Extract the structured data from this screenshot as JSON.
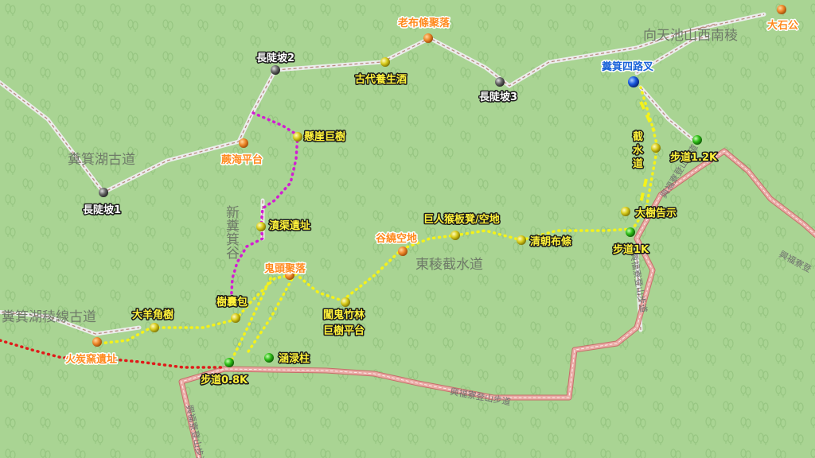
{
  "colors": {
    "background": "#a9d493",
    "road_fill": "#e9a9a4",
    "road_edge": "#c66e6a",
    "trail": "#e6e6e6",
    "trail_dash": "#b98a80",
    "magenta_path": "#d21ed2",
    "yellow_path": "#f4f21a",
    "red_path": "#e01a1a"
  },
  "area_labels": {
    "xiang_tian_chi": "向天池山西南稜",
    "ji_ji_hu_old_road": "糞箕湖古道",
    "xin_ji_ji_gu": "新糞箕谷",
    "ji_ji_hu_ridge_road": "糞箕湖稜線古道",
    "dong_ling": "東稜截水道"
  },
  "road_labels": {
    "xing_fu_bottom": "興福寮登山步道",
    "xing_fu_right_1": "興福寮登山步道",
    "xing_fu_right_2": "興福寮登山步道",
    "xing_fu_left": "興福寮登山步道",
    "xing_fu_far_right": "興福寮登"
  },
  "markers": {
    "da_shi_gong": {
      "label": "大石公",
      "icon": "orange-pin-icon"
    },
    "lao_bu_tiao": {
      "label": "老布條聚落",
      "icon": "orange-pin-icon"
    },
    "chang_dou_po_2": {
      "label": "長陡坡2",
      "icon": "gray-pin-icon"
    },
    "gu_dai_yang_sheng": {
      "label": "古代養生酒",
      "icon": "yellow-pin-icon"
    },
    "chang_dou_po_3": {
      "label": "長陡坡3",
      "icon": "gray-pin-icon"
    },
    "ji_ji_si_lu_cha": {
      "label": "糞箕四路叉",
      "icon": "blue-pin-icon"
    },
    "xuan_ya_ju_shu": {
      "label": "懸崖巨樹",
      "icon": "yellow-pin-icon"
    },
    "jue_hai_ping_tai": {
      "label": "蕨海平台",
      "icon": "orange-pin-icon"
    },
    "jie_shui_dao": {
      "label_lines": [
        "截",
        "水",
        "道"
      ],
      "icon": "yellow-pin-icon"
    },
    "bu_dao_12k": {
      "label": "步道1.2K",
      "icon": "green-pin-icon"
    },
    "chang_dou_po_1": {
      "label": "長陡坡1",
      "icon": "gray-pin-icon"
    },
    "da_shu_gao_shi": {
      "label": "大樹告示",
      "icon": "yellow-pin-icon"
    },
    "ju_ren_hou_ban_deng": {
      "label": "巨人猴板凳/空地",
      "icon": "yellow-pin-icon"
    },
    "gou_qu_yi_zhi": {
      "label": "濆渠遺址",
      "icon": "yellow-pin-icon"
    },
    "gu_jing_kong_di": {
      "label": "谷繞空地",
      "icon": "orange-pin-icon"
    },
    "qing_chao_bu_tiao": {
      "label": "清朝布條",
      "icon": "yellow-pin-icon"
    },
    "bu_dao_1k": {
      "label": "步道1K",
      "icon": "green-pin-icon"
    },
    "gui_tou_ju_luo": {
      "label": "鬼頭聚落",
      "icon": "orange-pin-icon"
    },
    "chuang_gui_zhu_lin": {
      "label_lines": [
        "闖鬼竹林",
        "巨樹平台"
      ],
      "icon": "yellow-pin-icon"
    },
    "shu_nang_bao": {
      "label": "樹囊包",
      "icon": "yellow-pin-icon"
    },
    "da_yang_jiao_shu": {
      "label": "大羊角樹",
      "icon": "yellow-pin-icon"
    },
    "huo_tan_yao_yi_zhi": {
      "label": "火炭窯遺址",
      "icon": "orange-pin-icon"
    },
    "xiao_lu_zhu": {
      "label": "涵渌柱",
      "icon": "green-pin-icon"
    },
    "bu_dao_08k": {
      "label": "步道0.8K",
      "icon": "green-pin-icon"
    }
  }
}
